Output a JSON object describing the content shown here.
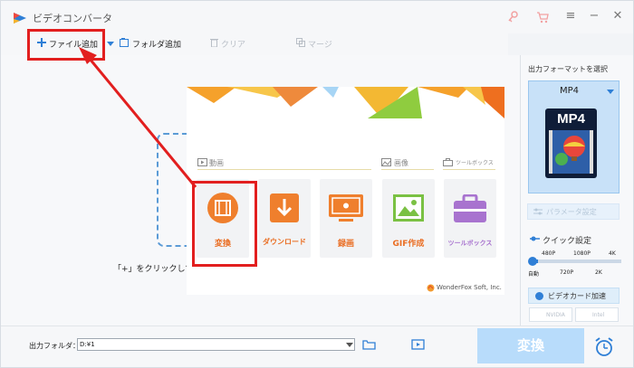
{
  "app": {
    "title": "ビデオコンバータ",
    "icons": [
      "app-logo-icon",
      "key-icon",
      "cart-icon",
      "menu-icon",
      "minimize-icon",
      "close-icon"
    ]
  },
  "toolbar": {
    "add_file": "ファイル追加",
    "add_folder": "フォルダ追加",
    "clear": "クリア",
    "merge": "マージ"
  },
  "main": {
    "hint": "「+」をクリックしてフ"
  },
  "panel": {
    "sections": {
      "video": "動画",
      "image": "画像",
      "toolbox": "ツールボックス"
    },
    "cards": [
      {
        "label": "変換",
        "icon": "film-convert-icon"
      },
      {
        "label": "ダウンロード",
        "icon": "download-icon"
      },
      {
        "label": "録画",
        "icon": "screen-record-icon"
      },
      {
        "label": "GIF作成",
        "icon": "gif-image-icon"
      },
      {
        "label": "ツールボックス",
        "icon": "toolbox-icon"
      }
    ],
    "brand": "WonderFox Soft, Inc."
  },
  "sidebar": {
    "title": "出力フォーマットを選択",
    "format": "MP4",
    "format_icon": "MP4",
    "param_button": "パラメータ設定",
    "quick": "クイック設定",
    "ticks_top": [
      "480P",
      "1080P",
      "4K"
    ],
    "ticks_bottom": [
      "自動",
      "720P",
      "2K"
    ],
    "gpu": "ビデオカード加速",
    "nvidia": "NVIDIA",
    "intel": "Intel"
  },
  "bottom": {
    "output_label": "出力フォルダ：",
    "output_path": "D:¥1",
    "convert": "変換"
  },
  "colors": {
    "accent": "#2f7fd6",
    "orange": "#ea6d22",
    "red": "#e21f1f"
  }
}
